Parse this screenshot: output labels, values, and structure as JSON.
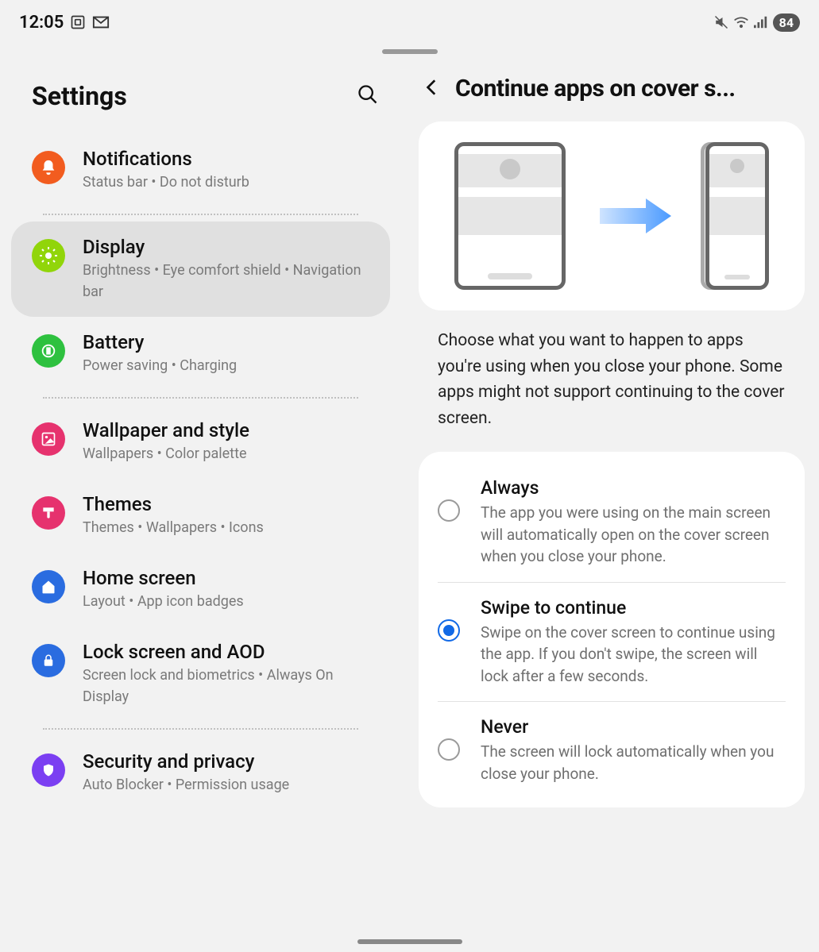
{
  "status": {
    "time": "12:05",
    "battery": "84"
  },
  "left": {
    "title": "Settings",
    "items": [
      {
        "title": "Notifications",
        "sub": "Status bar  •  Do not disturb"
      },
      {
        "title": "Display",
        "sub": "Brightness  •  Eye comfort shield  •  Navigation bar"
      },
      {
        "title": "Battery",
        "sub": "Power saving  •  Charging"
      },
      {
        "title": "Wallpaper and style",
        "sub": "Wallpapers  •  Color palette"
      },
      {
        "title": "Themes",
        "sub": "Themes  •  Wallpapers  •  Icons"
      },
      {
        "title": "Home screen",
        "sub": "Layout  •  App icon badges"
      },
      {
        "title": "Lock screen and AOD",
        "sub": "Screen lock and biometrics  •  Always On Display"
      },
      {
        "title": "Security and privacy",
        "sub": "Auto Blocker  •  Permission usage"
      }
    ]
  },
  "right": {
    "title": "Continue apps on cover s...",
    "description": "Choose what you want to happen to apps you're using when you close your phone. Some apps might not support continuing to the cover screen.",
    "options": [
      {
        "title": "Always",
        "sub": "The app you were using on the main screen will automatically open on the cover screen when you close your phone."
      },
      {
        "title": "Swipe to continue",
        "sub": "Swipe on the cover screen to continue using the app. If you don't swipe, the screen will lock after a few seconds."
      },
      {
        "title": "Never",
        "sub": "The screen will lock automatically when you close your phone."
      }
    ],
    "selected_index": 1
  }
}
